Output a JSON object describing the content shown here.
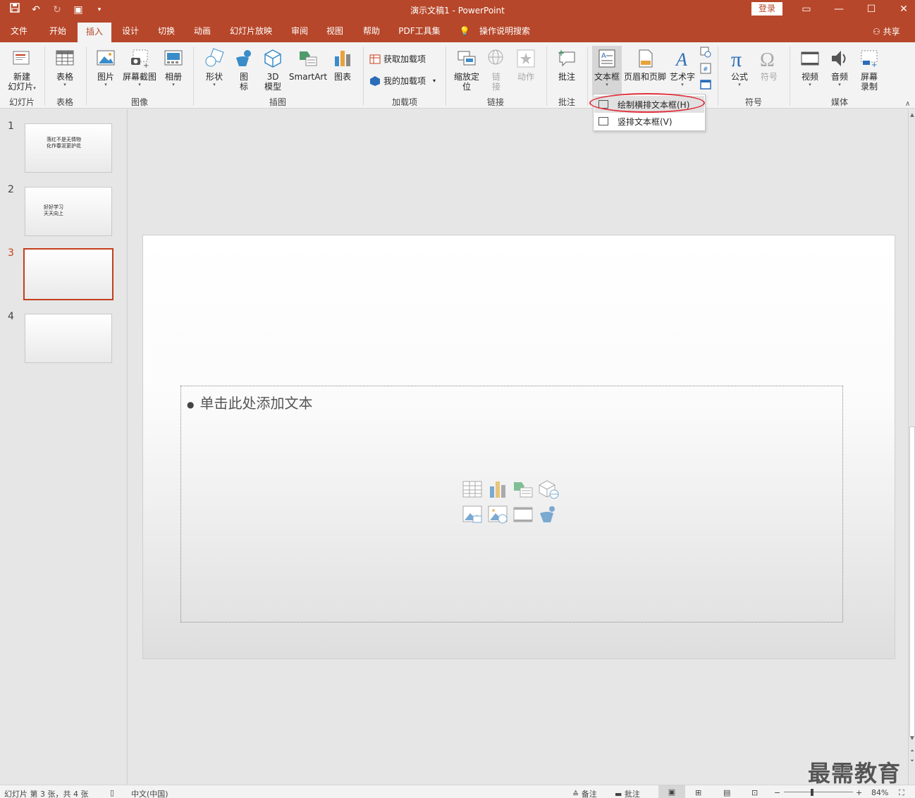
{
  "window": {
    "title": "演示文稿1  -  PowerPoint",
    "login_label": "登录",
    "share_label": "共享"
  },
  "tabs": [
    {
      "label": "文件"
    },
    {
      "label": "开始"
    },
    {
      "label": "插入"
    },
    {
      "label": "设计"
    },
    {
      "label": "切换"
    },
    {
      "label": "动画"
    },
    {
      "label": "幻灯片放映"
    },
    {
      "label": "审阅"
    },
    {
      "label": "视图"
    },
    {
      "label": "帮助"
    },
    {
      "label": "PDF工具集"
    },
    {
      "label": "操作说明搜索"
    }
  ],
  "ribbon": {
    "new_slide": "新建\n幻灯片",
    "table": "表格",
    "picture": "图片",
    "screenshot": "屏幕截图",
    "album": "相册",
    "shapes": "形状",
    "icons": "图\n标",
    "model3d": "3D\n模型",
    "smartart": "SmartArt",
    "chart": "图表",
    "get_addins": "获取加载项",
    "my_addins": "我的加载项",
    "zoom": "缩放定\n位",
    "link": "链\n接",
    "action": "动作",
    "comment": "批注",
    "textbox": "文本框",
    "header_footer": "页眉和页脚",
    "wordart": "艺术字",
    "equation": "公式",
    "symbol": "符号",
    "video": "视频",
    "audio": "音频",
    "screen_record": "屏幕\n录制",
    "groups": {
      "slides": "幻灯片",
      "tables": "表格",
      "images": "图像",
      "illustrations": "插图",
      "addins": "加载项",
      "links": "链接",
      "comments": "批注",
      "symbols": "符号",
      "media": "媒体"
    }
  },
  "textbox_menu": {
    "items": [
      {
        "label": "绘制横排文本框(H)"
      },
      {
        "label": "竖排文本框(V)"
      }
    ]
  },
  "slides": [
    {
      "num": "1",
      "text": "落红不是无情物\n化作春泥更护花"
    },
    {
      "num": "2",
      "text": "好好学习\n天天向上"
    },
    {
      "num": "3",
      "text": ""
    },
    {
      "num": "4",
      "text": ""
    }
  ],
  "current_slide": {
    "placeholder_text": "单击此处添加文本"
  },
  "statusbar": {
    "slide_info": "幻灯片 第 3 张，共 4 张",
    "language": "中文(中国)",
    "notes": "备注",
    "comments": "批注",
    "zoom": "84%"
  },
  "watermark": "最需教育",
  "colors": {
    "accent": "#b7472a",
    "highlight_ring": "#e0303c",
    "current_slide_border": "#c43e1c"
  }
}
